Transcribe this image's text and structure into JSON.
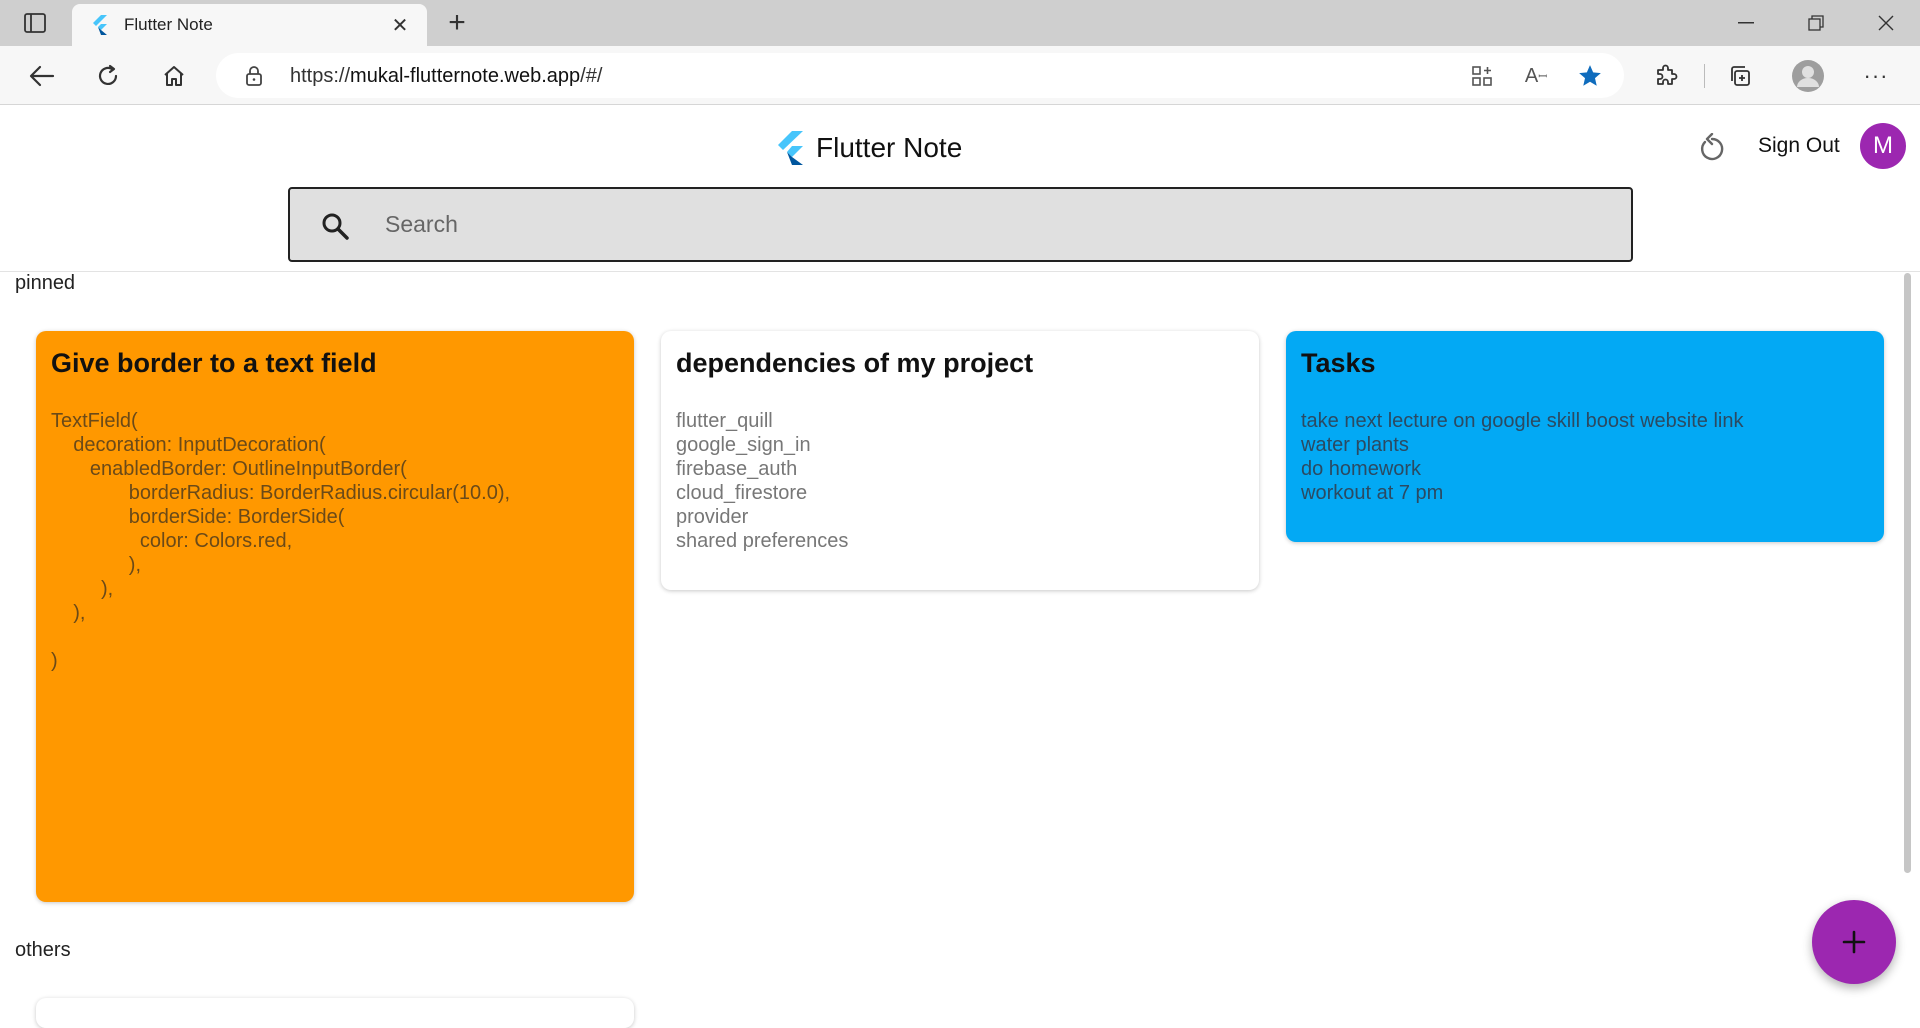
{
  "browser": {
    "tab_title": "Flutter Note",
    "url_prefix": "https://",
    "url_host": "mukal-flutternote.web.app",
    "url_path": "/#/"
  },
  "app": {
    "title": "Flutter Note",
    "sign_out_label": "Sign Out",
    "avatar_initial": "M",
    "search_placeholder": "Search",
    "accent_color": "#9c27b0"
  },
  "sections": {
    "pinned_label": "pinned",
    "others_label": "others"
  },
  "pinned_notes": [
    {
      "title": "Give border to a text field",
      "body": "TextField(\n    decoration: InputDecoration(\n       enabledBorder: OutlineInputBorder(\n              borderRadius: BorderRadius.circular(10.0),\n              borderSide: BorderSide(\n                color: Colors.red,\n              ),\n         ),\n    ),\n\n)",
      "color": "#ff9800"
    },
    {
      "title": "dependencies of my project",
      "body": "flutter_quill\ngoogle_sign_in\nfirebase_auth\ncloud_firestore\nprovider\nshared preferences",
      "color": "#ffffff"
    },
    {
      "title": "Tasks",
      "body": "take next lecture on google skill boost website link\nwater plants\ndo homework\nworkout at 7 pm",
      "color": "#03a9f4"
    }
  ]
}
